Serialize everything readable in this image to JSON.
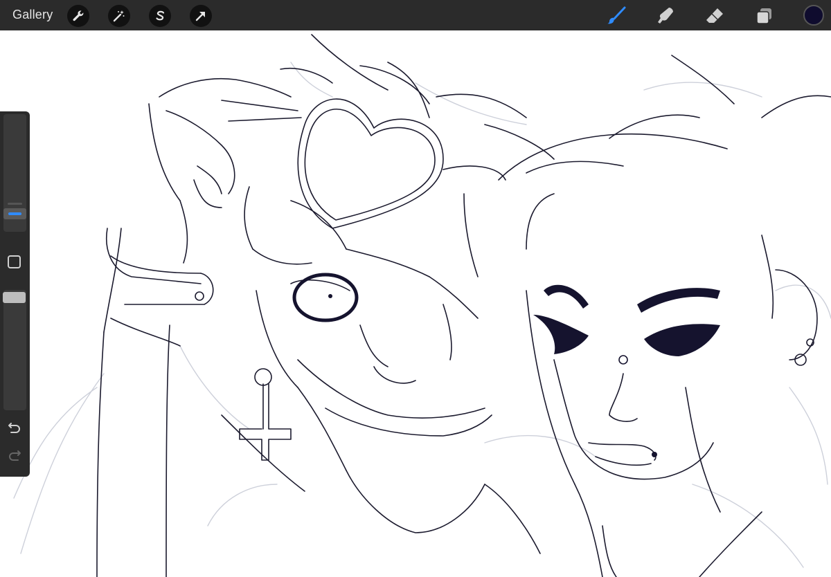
{
  "topbar": {
    "gallery_label": "Gallery",
    "left_tools": [
      {
        "name": "actions",
        "icon": "wrench-icon"
      },
      {
        "name": "adjustments",
        "icon": "magic-wand-icon"
      },
      {
        "name": "selection",
        "icon": "selection-s-icon"
      },
      {
        "name": "transform",
        "icon": "arrow-cursor-icon"
      }
    ],
    "right_tools": [
      {
        "name": "brush",
        "icon": "brush-icon",
        "active": true
      },
      {
        "name": "smudge",
        "icon": "smudge-finger-icon",
        "active": false
      },
      {
        "name": "eraser",
        "icon": "eraser-icon",
        "active": false
      },
      {
        "name": "layers",
        "icon": "layers-icon",
        "active": false
      }
    ],
    "current_color": "#0f0c2e"
  },
  "sidebar": {
    "brush_size_level": 0.18,
    "opacity_level": 0.0,
    "modify_icon": "square-modify-icon",
    "undo_icon": "undo-icon",
    "redo_icon": "redo-icon"
  },
  "colors": {
    "accent": "#2f8cff",
    "ink": "#15132e",
    "sketch": "#c8cbd6",
    "toolbar": "#2b2b2b"
  }
}
